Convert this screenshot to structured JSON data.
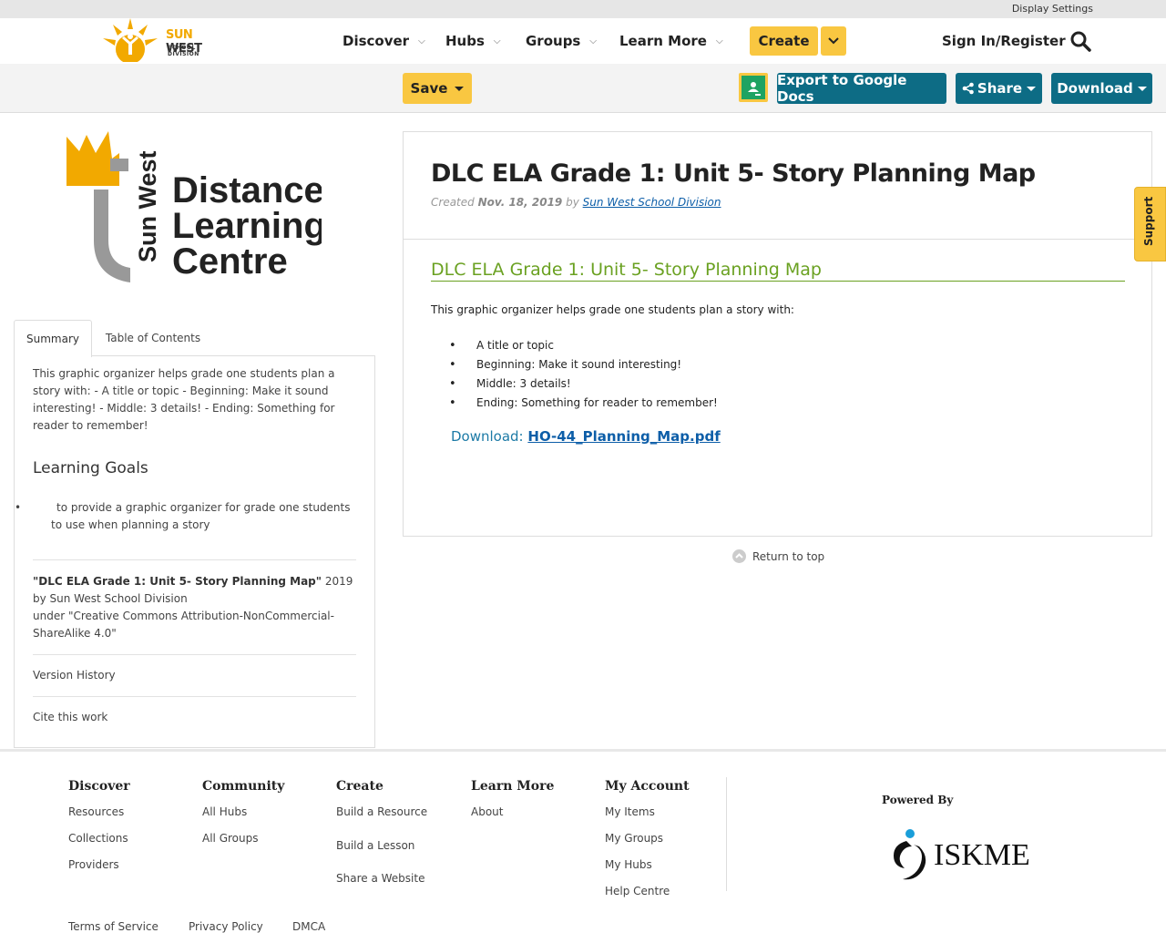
{
  "utility": {
    "display_settings": "Display Settings"
  },
  "header": {
    "logo_sun": "SUN",
    "logo_west": " WEST",
    "logo_sub": "SCHOOL DIVISION",
    "nav": [
      {
        "label": "Discover"
      },
      {
        "label": "Hubs"
      },
      {
        "label": "Groups"
      },
      {
        "label": "Learn More"
      }
    ],
    "create_label": "Create",
    "signin_label": "Sign In/Register"
  },
  "toolbar": {
    "save_label": "Save",
    "export_label": "Export to Google Docs",
    "share_label": "Share",
    "download_label": "Download"
  },
  "sidebar": {
    "logo_name_line1": "Distance",
    "logo_name_line2": "Learning",
    "logo_name_line3": "Centre",
    "logo_vertical": "Sun West",
    "tabs": [
      {
        "label": "Summary"
      },
      {
        "label": "Table of Contents"
      }
    ],
    "summary": "This graphic organizer helps grade one students plan a story with: - A title or topic - Beginning: Make it sound interesting! - Middle: 3 details! - Ending: Something for reader to remember!",
    "learning_goals_title": "Learning Goals",
    "learning_goals": [
      "to provide a graphic organizer for grade one students to use when planning a story"
    ],
    "license_title": "\"DLC ELA Grade 1: Unit 5- Story Planning Map\"",
    "license_rest": " 2019 by Sun West School Division",
    "license_under": "under \"Creative Commons Attribution-NonCommercial-ShareAlike 4.0\"",
    "version_history": "Version History",
    "cite": "Cite this work"
  },
  "main": {
    "title": "DLC ELA Grade 1: Unit 5- Story Planning Map",
    "created_prefix": "Created ",
    "created_date": "Nov. 18, 2019",
    "by": " by ",
    "author": "Sun West School Division",
    "section_title": "DLC ELA Grade 1: Unit 5- Story Planning Map",
    "intro": "This graphic organizer helps grade one students plan a story with:",
    "list": [
      "A title or topic",
      "Beginning: Make it sound interesting!",
      "Middle: 3 details!",
      "Ending: Something for reader to remember!"
    ],
    "download_prefix": "Download: ",
    "download_file": "HO-44_Planning_Map.pdf",
    "return_top": "Return to top"
  },
  "support": {
    "label": "Support"
  },
  "footer": {
    "columns": [
      {
        "title": "Discover",
        "links": [
          "Resources",
          "Collections",
          "Providers"
        ]
      },
      {
        "title": "Community",
        "links": [
          "All Hubs",
          "All Groups"
        ]
      },
      {
        "title": "Create",
        "links": [
          "Build a Resource",
          "Build a Lesson",
          "Share a Website"
        ]
      },
      {
        "title": "Learn More",
        "links": [
          "About"
        ]
      },
      {
        "title": "My Account",
        "links": [
          "My Items",
          "My Groups",
          "My Hubs",
          "Help Centre"
        ]
      }
    ],
    "powered_by": "Powered By",
    "iskme": "ISKME",
    "bottom_links": [
      "Terms of Service",
      "Privacy Policy",
      "DMCA"
    ]
  },
  "colors": {
    "accent_yellow": "#f9c741",
    "teal": "#0d6c85",
    "green_heading": "#6aa121",
    "link_blue": "#0d5ea8"
  }
}
